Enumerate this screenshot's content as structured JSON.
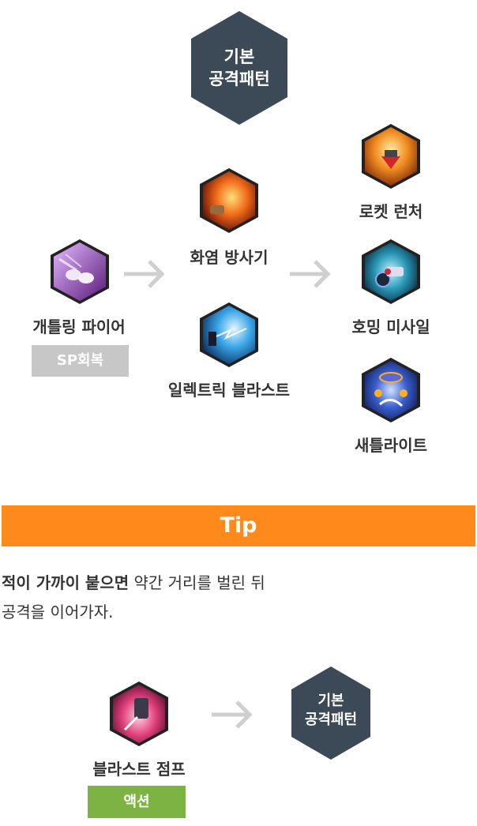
{
  "top_node": {
    "line1": "기본",
    "line2": "공격패턴"
  },
  "skills": {
    "gatling": {
      "label": "개틀링 파이어",
      "badge": "SP회복",
      "icon": "gatling-icon"
    },
    "flamethrower": {
      "label": "화염 방사기",
      "icon": "flamethrower-icon"
    },
    "electric": {
      "label": "일렉트릭 블라스트",
      "icon": "electric-blast-icon"
    },
    "rocket": {
      "label": "로켓 런처",
      "icon": "rocket-launcher-icon"
    },
    "homing": {
      "label": "호밍 미사일",
      "icon": "homing-missile-icon"
    },
    "satellite": {
      "label": "새틀라이트",
      "icon": "satellite-icon"
    },
    "blast_jump": {
      "label": "블라스트 점프",
      "badge": "액션",
      "icon": "blast-jump-icon"
    }
  },
  "tip": {
    "title": "Tip",
    "bold": "적이 가까이 붙으면",
    "line1_rest": " 약간 거리를 벌린 뒤",
    "line2": "공격을 이어가자."
  },
  "bottom_node": {
    "line1": "기본",
    "line2": "공격패턴"
  },
  "colors": {
    "hex_dark": "#3c4a57",
    "tip_orange": "#ff8a1c",
    "badge_gray": "#c7c7c7",
    "badge_green": "#7cb342",
    "arrow_gray": "#cfcfcf"
  }
}
